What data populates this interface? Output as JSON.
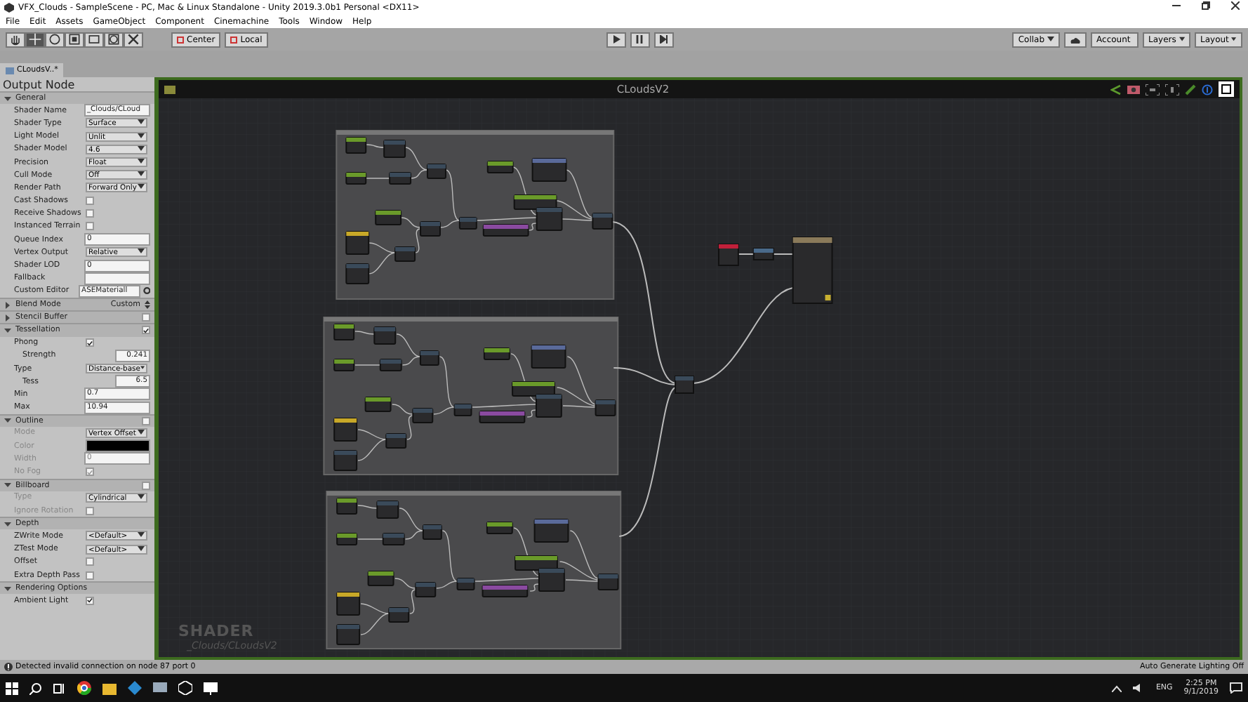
{
  "window": {
    "title": "VFX_Clouds - SampleScene - PC, Mac & Linux Standalone - Unity 2019.3.0b1 Personal <DX11>"
  },
  "menu": [
    "File",
    "Edit",
    "Assets",
    "GameObject",
    "Component",
    "Cinemachine",
    "Tools",
    "Window",
    "Help"
  ],
  "toolbar": {
    "tools": [
      {
        "kind": "hand",
        "selected": false
      },
      {
        "kind": "move",
        "selected": true
      },
      {
        "kind": "rotate",
        "selected": false
      },
      {
        "kind": "scale",
        "selected": false
      },
      {
        "kind": "rect",
        "selected": false
      },
      {
        "kind": "transform",
        "selected": false
      },
      {
        "kind": "custom",
        "selected": false
      }
    ],
    "pivot": [
      "Center",
      "Local"
    ],
    "collab": "Collab",
    "account": "Account",
    "layers": "Layers",
    "layout": "Layout"
  },
  "tab": {
    "label": "CLoudsV..*"
  },
  "inspector": {
    "title": "Output Node",
    "sections": [
      {
        "label": "General",
        "expanded": true,
        "rows": [
          {
            "label": "Shader Name",
            "kind": "text",
            "value": "_Clouds/CLoud"
          },
          {
            "label": "Shader Type",
            "kind": "dropdown",
            "value": "Surface"
          },
          {
            "label": "Light Model",
            "kind": "dropdown",
            "value": "Unlit"
          },
          {
            "label": "Shader Model",
            "kind": "dropdown",
            "value": "4.6"
          },
          {
            "label": "Precision",
            "kind": "dropdown",
            "value": "Float"
          },
          {
            "label": "Cull Mode",
            "kind": "dropdown",
            "value": "Off"
          },
          {
            "label": "Render Path",
            "kind": "dropdown",
            "value": "Forward Only"
          },
          {
            "label": "Cast Shadows",
            "kind": "check",
            "checked": false
          },
          {
            "label": "Receive Shadows",
            "kind": "check",
            "checked": false
          },
          {
            "label": "Instanced Terrain",
            "kind": "check",
            "checked": false
          },
          {
            "label": "Queue Index",
            "kind": "text",
            "value": "0"
          },
          {
            "label": "Vertex Output",
            "kind": "dropdown",
            "value": "Relative"
          },
          {
            "label": "Shader LOD",
            "kind": "text",
            "value": "0"
          },
          {
            "label": "Fallback",
            "kind": "text"
          },
          {
            "label": "Custom Editor",
            "kind": "gear_text",
            "value": "ASEMateriall"
          }
        ]
      },
      {
        "label": "Blend Mode",
        "expanded": false,
        "value": "Custom"
      },
      {
        "label": "Stencil Buffer",
        "expanded": false,
        "toggle": false
      },
      {
        "label": "Tessellation",
        "expanded": true,
        "toggle": true,
        "rows": [
          {
            "label": "Phong",
            "kind": "check",
            "checked": true
          },
          {
            "label": "Strength",
            "kind": "number",
            "value": "0.241"
          },
          {
            "label": "Type",
            "kind": "dropdown",
            "value": "Distance-base"
          },
          {
            "label": "Tess",
            "kind": "number",
            "value": "6.5"
          },
          {
            "label": "Min",
            "kind": "text",
            "value": "0.7"
          },
          {
            "label": "Max",
            "kind": "text",
            "value": "10.94"
          }
        ]
      },
      {
        "label": "Outline",
        "expanded": true,
        "toggle": false,
        "rows": [
          {
            "label": "Mode",
            "kind": "dropdown",
            "value": "Vertex Offset"
          },
          {
            "label": "Color",
            "kind": "color",
            "color": "#000000"
          },
          {
            "label": "Width",
            "kind": "text",
            "value": "0"
          },
          {
            "label": "No Fog",
            "kind": "check",
            "checked": true
          }
        ]
      },
      {
        "label": "Billboard",
        "expanded": true,
        "toggle": false,
        "rows": [
          {
            "label": "Type",
            "kind": "dropdown",
            "value": "Cylindrical"
          },
          {
            "label": "Ignore Rotation",
            "kind": "check",
            "checked": false
          }
        ]
      },
      {
        "label": "Depth",
        "expanded": true,
        "rows": [
          {
            "label": "ZWrite Mode",
            "kind": "dropdown",
            "value": "<Default>"
          },
          {
            "label": "ZTest Mode",
            "kind": "dropdown",
            "value": "<Default>"
          },
          {
            "label": "Offset",
            "kind": "check",
            "checked": false
          },
          {
            "label": "Extra Depth Pass",
            "kind": "check",
            "checked": false
          }
        ]
      },
      {
        "label": "Rendering Options",
        "expanded": true,
        "rows": [
          {
            "label": "Ambient Light",
            "kind": "check",
            "checked": true
          }
        ]
      }
    ]
  },
  "canvas": {
    "title": "CLoudsV2",
    "watermark": "SHADER",
    "shader_path": "_Clouds/CLoudsV2"
  },
  "status": {
    "message": "Detected invalid connection on node 87 port 0",
    "lighting": "Auto Generate Lighting Off"
  },
  "taskbar": {
    "language": "ENG",
    "time": "2:25 PM",
    "date": "9/1/2019"
  }
}
